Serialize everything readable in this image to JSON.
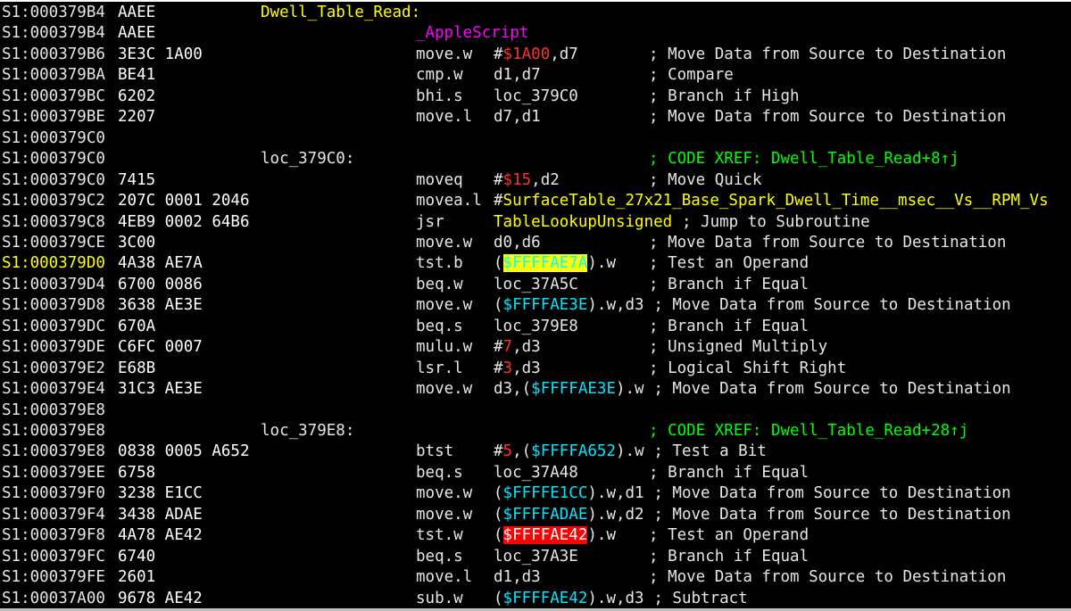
{
  "colors": {
    "background": "#000000",
    "address": "#e6e6e6",
    "address_highlight": "#ffff00",
    "label": "#ffff00",
    "apple_script": "#ff00ff",
    "immediate": "#ff3030",
    "variable": "#00e5ff",
    "xref_comment": "#00ff00",
    "highlight_yellow": "#ffff00",
    "highlight_red": "#ff0000"
  },
  "listing": [
    {
      "addr": "S1:000379B4",
      "bytes": "AAEE",
      "label": "Dwell_Table_Read:"
    },
    {
      "addr": "S1:000379B4",
      "bytes": "AAEE",
      "apple": "_AppleScript"
    },
    {
      "addr": "S1:000379B6",
      "bytes": "3E3C 1A00",
      "mnem": "move.w",
      "ops": [
        {
          "t": "#"
        },
        {
          "t": "$1A00",
          "c": "imm"
        },
        {
          "t": ",d7"
        }
      ],
      "comment": "; Move Data from Source to Destination"
    },
    {
      "addr": "S1:000379BA",
      "bytes": "BE41",
      "mnem": "cmp.w",
      "ops": [
        {
          "t": "d1,d7"
        }
      ],
      "comment": "; Compare"
    },
    {
      "addr": "S1:000379BC",
      "bytes": "6202",
      "mnem": "bhi.s",
      "ops": [
        {
          "t": "loc_379C0"
        }
      ],
      "comment": "; Branch if High"
    },
    {
      "addr": "S1:000379BE",
      "bytes": "2207",
      "mnem": "move.l",
      "ops": [
        {
          "t": "d7,d1"
        }
      ],
      "comment": "; Move Data from Source to Destination"
    },
    {
      "addr": "S1:000379C0"
    },
    {
      "addr": "S1:000379C0",
      "loc": "loc_379C0:",
      "xref": "; CODE XREF: Dwell_Table_Read+8↑j"
    },
    {
      "addr": "S1:000379C0",
      "bytes": "7415",
      "mnem": "moveq",
      "ops": [
        {
          "t": "#"
        },
        {
          "t": "$15",
          "c": "imm"
        },
        {
          "t": ",d2"
        }
      ],
      "comment": "; Move Quick"
    },
    {
      "addr": "S1:000379C2",
      "bytes": "207C 0001 2046",
      "mnem": "movea.l",
      "ops": [
        {
          "t": "#"
        },
        {
          "t": "SurfaceTable_27x21_Base_Spark_Dwell_Time__msec__Vs__RPM_Vs",
          "c": "sym"
        }
      ]
    },
    {
      "addr": "S1:000379C8",
      "bytes": "4EB9 0002 64B6",
      "mnem": "jsr",
      "ops": [
        {
          "t": "TableLookupUnsigned",
          "c": "sym"
        }
      ],
      "comment": "; Jump to Subroutine",
      "inline": true
    },
    {
      "addr": "S1:000379CE",
      "bytes": "3C00",
      "mnem": "move.w",
      "ops": [
        {
          "t": "d0,d6"
        }
      ],
      "comment": "; Move Data from Source to Destination"
    },
    {
      "addr": "S1:000379D0",
      "addr_hl": true,
      "bytes": "4A38 AE7A",
      "mnem": "tst.b",
      "ops": [
        {
          "t": "("
        },
        {
          "t": "$FFFFAE7A",
          "c": "hlv"
        },
        {
          "t": ").w"
        }
      ],
      "comment": "; Test an Operand"
    },
    {
      "addr": "S1:000379D4",
      "bytes": "6700 0086",
      "mnem": "beq.w",
      "ops": [
        {
          "t": "loc_37A5C"
        }
      ],
      "comment": "; Branch if Equal"
    },
    {
      "addr": "S1:000379D8",
      "bytes": "3638 AE3E",
      "mnem": "move.w",
      "ops": [
        {
          "t": "("
        },
        {
          "t": "$FFFFAE3E",
          "c": "var"
        },
        {
          "t": ").w,d3"
        }
      ],
      "comment": "; Move Data from Source to Destination",
      "inline": true
    },
    {
      "addr": "S1:000379DC",
      "bytes": "670A",
      "mnem": "beq.s",
      "ops": [
        {
          "t": "loc_379E8"
        }
      ],
      "comment": "; Branch if Equal"
    },
    {
      "addr": "S1:000379DE",
      "bytes": "C6FC 0007",
      "mnem": "mulu.w",
      "ops": [
        {
          "t": "#"
        },
        {
          "t": "7",
          "c": "imm"
        },
        {
          "t": ",d3"
        }
      ],
      "comment": "; Unsigned Multiply"
    },
    {
      "addr": "S1:000379E2",
      "bytes": "E68B",
      "mnem": "lsr.l",
      "ops": [
        {
          "t": "#"
        },
        {
          "t": "3",
          "c": "imm"
        },
        {
          "t": ",d3"
        }
      ],
      "comment": "; Logical Shift Right"
    },
    {
      "addr": "S1:000379E4",
      "bytes": "31C3 AE3E",
      "mnem": "move.w",
      "ops": [
        {
          "t": "d3,("
        },
        {
          "t": "$FFFFAE3E",
          "c": "var"
        },
        {
          "t": ").w"
        }
      ],
      "comment": "; Move Data from Source to Destination",
      "inline": true
    },
    {
      "addr": "S1:000379E8"
    },
    {
      "addr": "S1:000379E8",
      "loc": "loc_379E8:",
      "xref": "; CODE XREF: Dwell_Table_Read+28↑j"
    },
    {
      "addr": "S1:000379E8",
      "bytes": "0838 0005 A652",
      "mnem": "btst",
      "ops": [
        {
          "t": "#"
        },
        {
          "t": "5",
          "c": "imm"
        },
        {
          "t": ",("
        },
        {
          "t": "$FFFFA652",
          "c": "var"
        },
        {
          "t": ").w"
        }
      ],
      "comment": "; Test a Bit",
      "inline": true
    },
    {
      "addr": "S1:000379EE",
      "bytes": "6758",
      "mnem": "beq.s",
      "ops": [
        {
          "t": "loc_37A48"
        }
      ],
      "comment": "; Branch if Equal"
    },
    {
      "addr": "S1:000379F0",
      "bytes": "3238 E1CC",
      "mnem": "move.w",
      "ops": [
        {
          "t": "("
        },
        {
          "t": "$FFFFE1CC",
          "c": "var"
        },
        {
          "t": ").w,d1"
        }
      ],
      "comment": "; Move Data from Source to Destination",
      "inline": true
    },
    {
      "addr": "S1:000379F4",
      "bytes": "3438 ADAE",
      "mnem": "move.w",
      "ops": [
        {
          "t": "("
        },
        {
          "t": "$FFFFADAE",
          "c": "var"
        },
        {
          "t": ").w,d2"
        }
      ],
      "comment": "; Move Data from Source to Destination",
      "inline": true
    },
    {
      "addr": "S1:000379F8",
      "bytes": "4A78 AE42",
      "mnem": "tst.w",
      "ops": [
        {
          "t": "("
        },
        {
          "t": "$FFFFAE42",
          "c": "hlr"
        },
        {
          "t": ").w"
        }
      ],
      "comment": "; Test an Operand"
    },
    {
      "addr": "S1:000379FC",
      "bytes": "6740",
      "mnem": "beq.s",
      "ops": [
        {
          "t": "loc_37A3E"
        }
      ],
      "comment": "; Branch if Equal"
    },
    {
      "addr": "S1:000379FE",
      "bytes": "2601",
      "mnem": "move.l",
      "ops": [
        {
          "t": "d1,d3"
        }
      ],
      "comment": "; Move Data from Source to Destination"
    },
    {
      "addr": "S1:00037A00",
      "bytes": "9678 AE42",
      "mnem": "sub.w",
      "ops": [
        {
          "t": "("
        },
        {
          "t": "$FFFFAE42",
          "c": "var"
        },
        {
          "t": ").w,d3"
        }
      ],
      "comment": "; Subtract",
      "inline": true
    }
  ]
}
